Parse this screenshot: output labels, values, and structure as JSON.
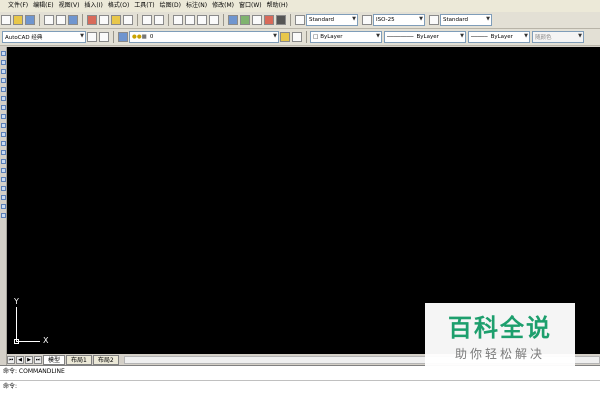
{
  "menu": [
    "文件(F)",
    "编辑(E)",
    "视图(V)",
    "插入(I)",
    "格式(O)",
    "工具(T)",
    "绘图(D)",
    "标注(N)",
    "修改(M)",
    "窗口(W)",
    "帮助(H)"
  ],
  "styles": {
    "text_style": "Standard",
    "dim_style": "ISO-25",
    "table_style": "Standard"
  },
  "workspace": "AutoCAD 经典",
  "layer": "0",
  "properties": {
    "color": "ByLayer",
    "linetype": "ByLayer",
    "lineweight": "ByLayer",
    "plot_style": "随颜色"
  },
  "ucs": {
    "x_label": "X",
    "y_label": "Y"
  },
  "tabs": [
    "模型",
    "布局1",
    "布局2"
  ],
  "tab_nav": [
    "⏮",
    "◀",
    "▶",
    "⏭"
  ],
  "command": {
    "history": "命令: COMMANDLINE",
    "prompt": "命令:"
  },
  "watermark": {
    "title": "百科全说",
    "subtitle": "助你轻松解决"
  }
}
